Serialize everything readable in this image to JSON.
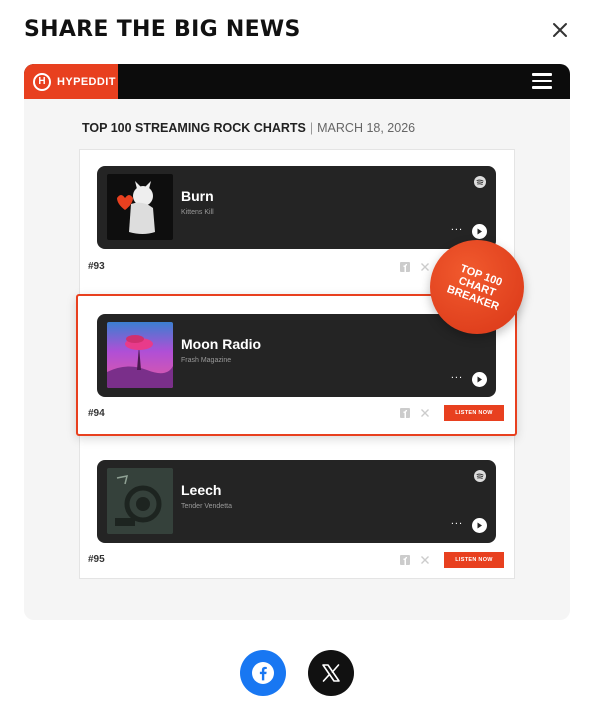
{
  "modal": {
    "title": "SHARE THE BIG NEWS",
    "close_icon": "close-icon"
  },
  "preview": {
    "brand": {
      "name": "HYPEDDIT",
      "logo_letter": "H",
      "color": "#e8401f"
    },
    "menu_icon": "hamburger-icon",
    "chart_title": "TOP 100 STREAMING ROCK CHARTS",
    "separator": "|",
    "chart_date": "MARCH 18, 2026",
    "badge": {
      "line1": "TOP 100",
      "line2": "CHART",
      "line3": "BREAKER"
    },
    "tracks": [
      {
        "rank": "#93",
        "title": "Burn",
        "artist": "Kittens Kill",
        "more": "...",
        "listen_label": ""
      },
      {
        "rank": "#94",
        "title": "Moon Radio",
        "artist": "Frash Magazine",
        "more": "...",
        "listen_label": "LISTEN NOW"
      },
      {
        "rank": "#95",
        "title": "Leech",
        "artist": "Tender Vendetta",
        "more": "...",
        "listen_label": "LISTEN NOW"
      }
    ]
  },
  "share_buttons": [
    {
      "name": "Facebook",
      "icon": "facebook-icon",
      "color": "#1877f2"
    },
    {
      "name": "X",
      "icon": "x-logo-icon",
      "color": "#111111"
    }
  ]
}
